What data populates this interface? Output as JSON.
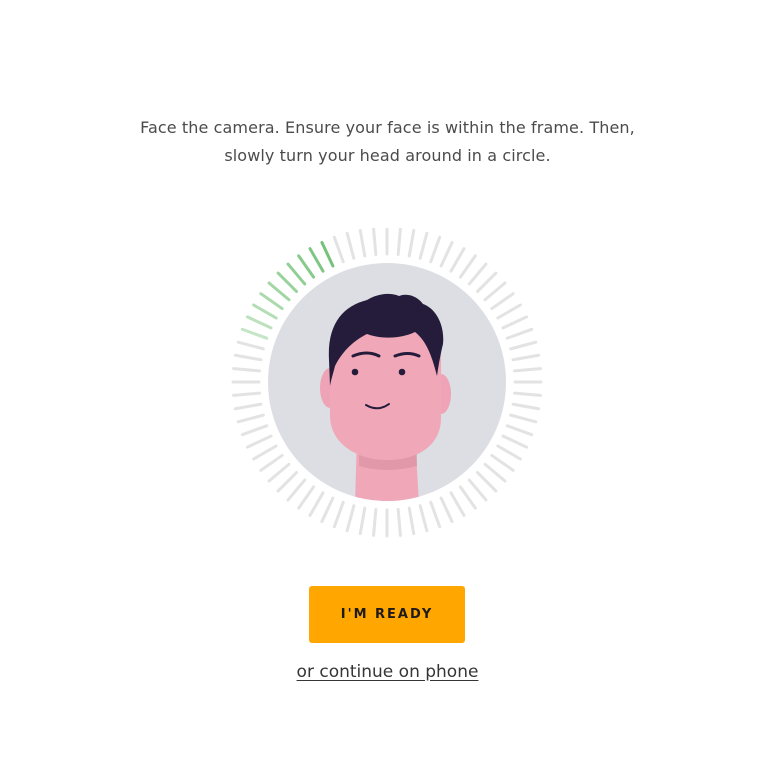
{
  "instructions": {
    "line1": "Face the camera. Ensure your face is within the frame. Then,",
    "line2": "slowly turn your head around in a circle."
  },
  "face_capture": {
    "avatar_icon": "face-avatar-illustration",
    "progress_ring": {
      "tick_count": 72,
      "completed_fraction": 0.14,
      "completed_color": "#6fbf73",
      "pending_color": "#e3e3e3"
    },
    "avatar_colors": {
      "background": "#dddee3",
      "skin": "#f0a8b9",
      "skin_shadow": "#d68d9e",
      "hair": "#241c3a"
    }
  },
  "actions": {
    "ready_label": "I'M READY",
    "ready_color": "#ffa600",
    "phone_link_label": "or continue on phone"
  }
}
